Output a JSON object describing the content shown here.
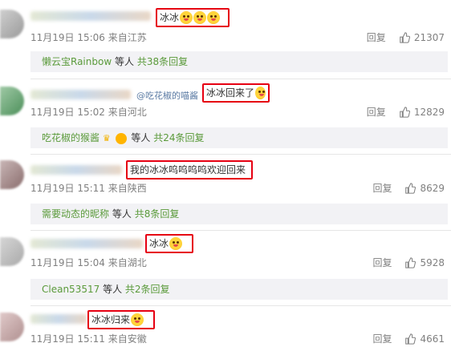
{
  "comments": [
    {
      "text": "冰冰",
      "date": "11月19日 15:06 来自江苏",
      "reply_label": "回复",
      "likes": "21307",
      "thread": {
        "user": "懒云宝Rainbow",
        "suffix": "等人",
        "count": "共38条回复"
      }
    },
    {
      "mention": "@吃花椒的喵酱",
      "text": "冰冰回来了",
      "date": "11月19日 15:02 来自河北",
      "reply_label": "回复",
      "likes": "12829",
      "thread": {
        "user": "吃花椒的猴酱",
        "suffix": "等人",
        "count": "共24条回复"
      }
    },
    {
      "text": "我的冰冰呜呜呜呜欢迎回来",
      "date": "11月19日 15:11 来自陕西",
      "reply_label": "回复",
      "likes": "8629",
      "thread": {
        "user": "需要动态的昵称",
        "suffix": "等人",
        "count": "共8条回复"
      }
    },
    {
      "text": "冰冰",
      "date": "11月19日 15:04 来自湖北",
      "reply_label": "回复",
      "likes": "5928",
      "thread": {
        "user": "Clean53517",
        "suffix": "等人",
        "count": "共2条回复"
      }
    },
    {
      "text": "冰冰归来",
      "date": "11月19日 15:11 来自安徽",
      "reply_label": "回复",
      "likes": "4661"
    }
  ],
  "colors": {
    "highlight": "#e60012",
    "link_green": "#5a9a3a",
    "meta_gray": "#808080"
  }
}
